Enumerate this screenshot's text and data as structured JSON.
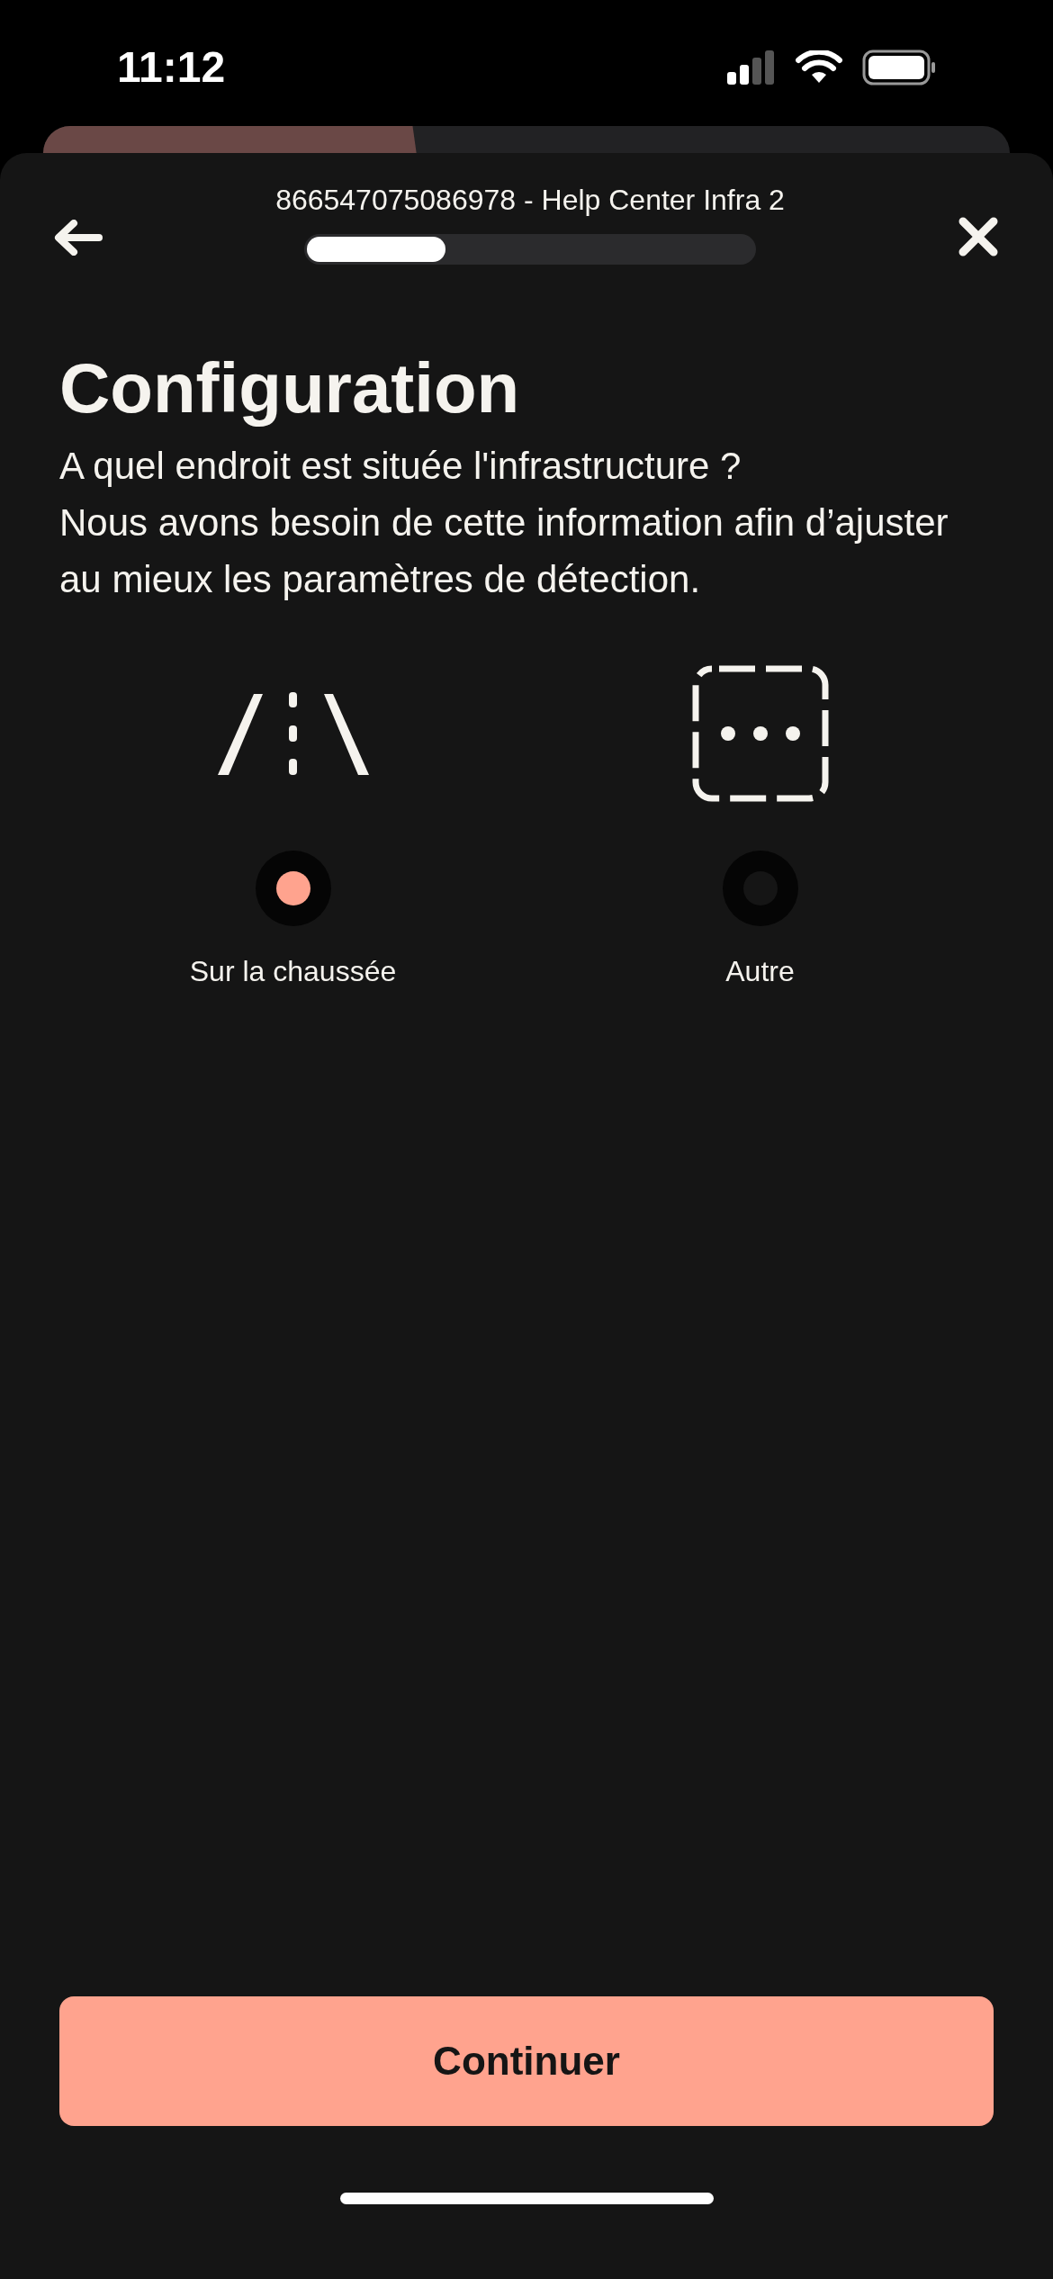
{
  "status_bar": {
    "time": "11:12"
  },
  "background_sheet": {
    "level": 0.39
  },
  "header": {
    "title": "866547075086978 - Help Center Infra 2",
    "progress": {
      "level": 0.31
    }
  },
  "heading": "Configuration",
  "description": "A quel endroit est située l'infrastructure ?\nNous avons besoin de cette information afin d’ajuster au mieux les paramètres de détection.",
  "options": [
    {
      "kind": "road",
      "label": "Sur la chaussée",
      "selected": true
    },
    {
      "kind": "other",
      "label": "Autre",
      "selected": false
    }
  ],
  "continue_button": "Continuer"
}
